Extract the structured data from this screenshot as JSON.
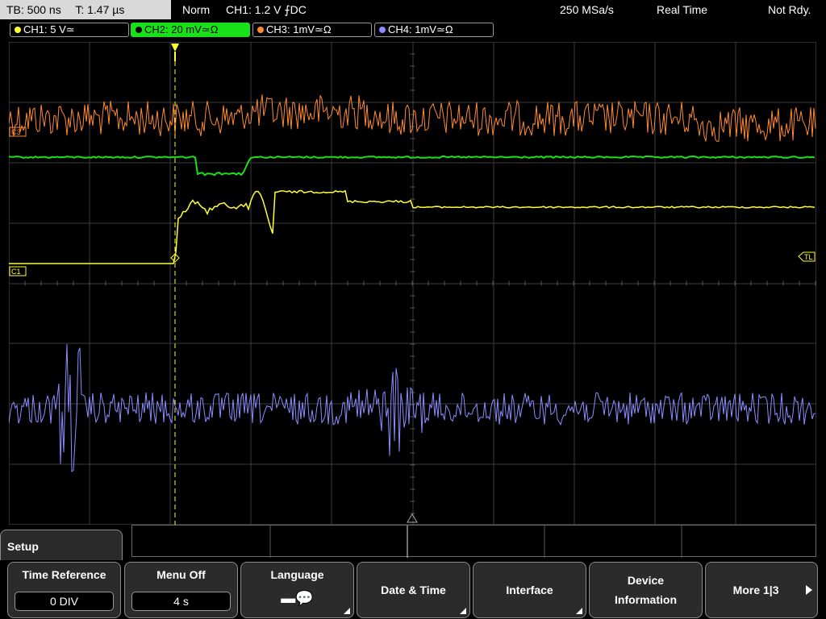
{
  "top": {
    "timebase": "TB: 500 ns",
    "trigger_time": "T: 1.47 µs",
    "mode": "Norm",
    "trigger": "CH1: 1.2 V ⨍DC",
    "sample_rate": "250 MSa/s",
    "acq_mode": "Real Time",
    "state": "Not Rdy."
  },
  "channels": [
    {
      "label": "CH1: 5 V≃",
      "color": "#ffff33"
    },
    {
      "label": "CH2: 20 mV≃Ω",
      "color": "#19e119"
    },
    {
      "label": "CH3: 1mV≃Ω",
      "color": "#ff8a33"
    },
    {
      "label": "CH4: 1mV≃Ω",
      "color": "#8c8cff"
    }
  ],
  "markers": {
    "c3": "C3",
    "c1": "C1",
    "trigger_level": "TL"
  },
  "menu": {
    "title": "Setup",
    "keys": [
      {
        "label": "Time Reference",
        "value": "0 DIV"
      },
      {
        "label": "Menu Off",
        "value": "4 s"
      },
      {
        "label": "Language",
        "icon": "speech-bubble-icon"
      },
      {
        "label": "Date & Time"
      },
      {
        "label": "Interface"
      },
      {
        "label": "Device",
        "label2": "Information"
      },
      {
        "label": "More 1|3"
      }
    ]
  }
}
